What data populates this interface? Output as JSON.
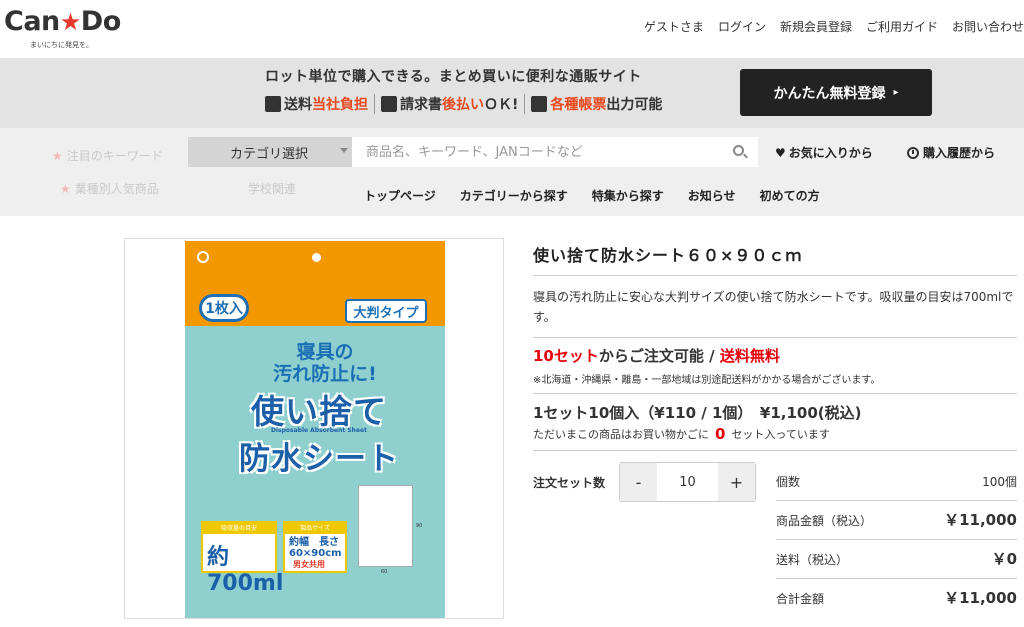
{
  "header": {
    "logo_left": "Can",
    "logo_star": "★",
    "logo_right": "Do",
    "tagline": "まいにちに発見を。",
    "nav": [
      "ゲストさま",
      "ログイン",
      "新規会員登録",
      "ご利用ガイド",
      "お問い合わせ"
    ]
  },
  "banner": {
    "headline": "ロット単位で購入できる。まとめ買いに便利な通販サイト",
    "feature1_a": "送料",
    "feature1_b": "当社負担",
    "feature2_a": "請求書",
    "feature2_b": "後払い",
    "feature2_c": "ＯＫ!",
    "feature3_a": "各種帳票",
    "feature3_b": "出力可能",
    "register_label": "かんたん無料登録",
    "register_arrow": "▸"
  },
  "search": {
    "category_label": "カテゴリ選択",
    "placeholder": "商品名、キーワード、JANコードなど",
    "favorites_label": "お気に入りから",
    "history_label": "購入履歴から",
    "ghost_1": "注目のキーワード",
    "ghost_2": "業種別人気商品",
    "ghost_3": "学校関連"
  },
  "main_nav": [
    "トップページ",
    "カテゴリーから探す",
    "特集から探す",
    "お知らせ",
    "初めての方"
  ],
  "product": {
    "title": "使い捨て防水シート６０×９０ｃｍ",
    "description": "寝具の汚れ防止に安心な大判サイズの使い捨て防水シートです。吸収量の目安は700mlです。",
    "min_order_red": "10セット",
    "min_order_mid": "からご注文可能 / ",
    "free_shipping": "送料無料",
    "shipping_note": "※北海道・沖縄県・離島・一部地域は別途配送料がかかる場合がございます。",
    "set_info": "1セット10個入（¥110 / 1個）　¥1,100(税込)",
    "cart_note_pre": "ただいまこの商品はお買い物かごに",
    "cart_count": "0",
    "cart_note_post": "セット入っています",
    "image": {
      "count_badge": "1枚入",
      "size_badge": "大判タイプ",
      "subtitle_1": "寝具の",
      "subtitle_2": "汚れ防止に!",
      "title_1": "使い捨て",
      "english": "Disposable Absorbent Sheet",
      "title_2": "防水シート",
      "box1_head": "吸収量の目安",
      "box1_value": "約700ml",
      "box2_head": "製品サイズ",
      "box2_value_1": "約幅　長さ",
      "box2_value_2": "60×90cm",
      "box2_unisex": "男女共用",
      "sheet_w": "60",
      "sheet_h": "90"
    }
  },
  "order": {
    "qty_label": "注文セット数",
    "minus": "-",
    "plus": "+",
    "qty_value": "10",
    "summary": [
      {
        "key": "個数",
        "value": "100個"
      },
      {
        "key": "商品金額（税込）",
        "value": "￥11,000"
      },
      {
        "key": "送料（税込）",
        "value": "￥0"
      },
      {
        "key": "合計金額",
        "value": "￥11,000"
      }
    ]
  }
}
